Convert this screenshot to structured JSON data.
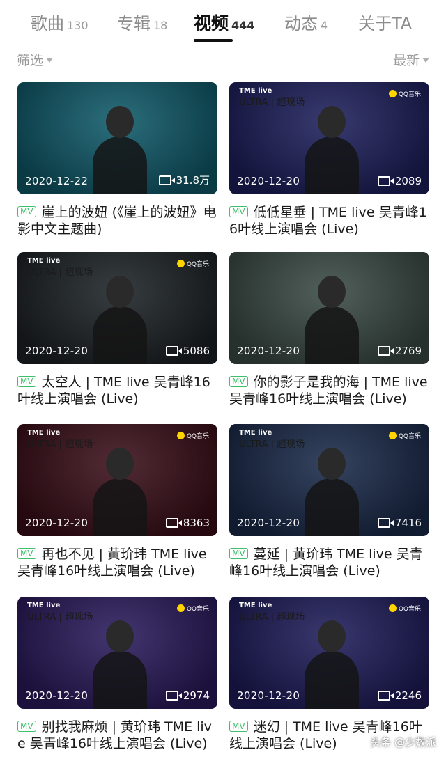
{
  "tabs": [
    {
      "label": "歌曲",
      "count": "130"
    },
    {
      "label": "专辑",
      "count": "18"
    },
    {
      "label": "视频",
      "count": "444"
    },
    {
      "label": "动态",
      "count": "4"
    },
    {
      "label": "关于TA",
      "count": ""
    }
  ],
  "active_tab": "视频",
  "filter": {
    "label": "筛选"
  },
  "sort": {
    "label": "最新"
  },
  "badge": "MV",
  "videos": [
    {
      "date": "2020-12-22",
      "views": "31.8万",
      "title": "崖上的波妞 (《崖上的波妞》电影中文主题曲)",
      "thumb_color": "#0f5a6a"
    },
    {
      "date": "2020-12-20",
      "views": "2089",
      "title": "低低星垂 | TME live 吴青峰16叶线上演唱会 (Live)",
      "thumb_color": "#1d1f5c"
    },
    {
      "date": "2020-12-20",
      "views": "5086",
      "title": "太空人 | TME live 吴青峰16叶线上演唱会 (Live)",
      "thumb_color": "#1c2226"
    },
    {
      "date": "2020-12-20",
      "views": "2769",
      "title": "你的影子是我的海 | TME live 吴青峰16叶线上演唱会 (Live)",
      "thumb_color": "#3a4a44"
    },
    {
      "date": "2020-12-20",
      "views": "8363",
      "title": "再也不见 | 黄玠玮 TME live 吴青峰16叶线上演唱会 (Live)",
      "thumb_color": "#3a0e18"
    },
    {
      "date": "2020-12-20",
      "views": "7416",
      "title": "蔓延 | 黄玠玮 TME live 吴青峰16叶线上演唱会 (Live)",
      "thumb_color": "#1a2a4a"
    },
    {
      "date": "2020-12-20",
      "views": "2974",
      "title": "别找我麻烦 | 黄玠玮 TME live 吴青峰16叶线上演唱会 (Live)",
      "thumb_color": "#2a1a5c"
    },
    {
      "date": "2020-12-20",
      "views": "2246",
      "title": "迷幻 | TME live 吴青峰16叶线上演唱会 (Live)",
      "thumb_color": "#1e1c5a"
    }
  ],
  "thumb_overlays": {
    "tme_logo": "TME live",
    "tme_sub": "ULTRA | 超现场",
    "qq_logo": "QQ音乐"
  },
  "watermark": "头条 @少数派"
}
